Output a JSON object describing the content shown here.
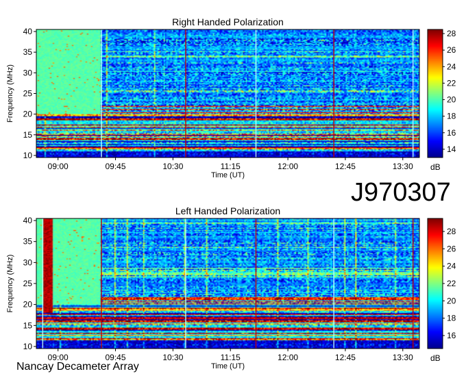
{
  "figure": {
    "observation_id": "J970307",
    "instrument": "Nancay Decameter Array"
  },
  "chart_data": [
    {
      "type": "heatmap",
      "title": "Right Handed Polarization",
      "xlabel": "Time (UT)",
      "ylabel": "Frequency (MHz)",
      "x_ticks": [
        "09:00",
        "09:45",
        "10:30",
        "11:15",
        "12:00",
        "12:45",
        "13:30"
      ],
      "x_tick_minutes": [
        540,
        585,
        630,
        675,
        720,
        765,
        810
      ],
      "xlim_minutes": [
        523,
        823
      ],
      "y_ticks": [
        10,
        15,
        20,
        25,
        30,
        35,
        40
      ],
      "ylim": [
        9.5,
        40.5
      ],
      "colorbar_label": "dB",
      "colorbar_ticks": [
        14,
        16,
        18,
        20,
        22,
        24,
        26,
        28
      ],
      "colorbar_range": [
        13,
        28.5
      ],
      "colorscale": [
        "#00008f",
        "#0000ff",
        "#0080ff",
        "#00ffff",
        "#80ff80",
        "#ffff00",
        "#ff8000",
        "#ff0000",
        "#800000"
      ],
      "grid": false,
      "vertical_lines_minutes": [
        574,
        640,
        695,
        756,
        818
      ],
      "block_end_minute": 573,
      "block_min_freq": 20
    },
    {
      "type": "heatmap",
      "title": "Left Handed Polarization",
      "xlabel": "Time (UT)",
      "ylabel": "Frequency (MHz)",
      "x_ticks": [
        "09:00",
        "09:45",
        "10:30",
        "11:15",
        "12:00",
        "12:45",
        "13:30"
      ],
      "x_tick_minutes": [
        540,
        585,
        630,
        675,
        720,
        765,
        810
      ],
      "xlim_minutes": [
        523,
        823
      ],
      "y_ticks": [
        10,
        15,
        20,
        25,
        30,
        35,
        40
      ],
      "ylim": [
        9.5,
        40.5
      ],
      "colorbar_label": "dB",
      "colorbar_ticks": [
        16,
        18,
        20,
        22,
        24,
        26,
        28
      ],
      "colorbar_range": [
        14.5,
        29.5
      ],
      "colorscale": [
        "#00008f",
        "#0000ff",
        "#0080ff",
        "#00ffff",
        "#80ff80",
        "#ffff00",
        "#ff8000",
        "#ff0000",
        "#800000"
      ],
      "grid": false,
      "vertical_lines_minutes": [
        528,
        574,
        640,
        695,
        756,
        818
      ],
      "block_end_minute": 573,
      "block_min_freq": 20
    }
  ]
}
